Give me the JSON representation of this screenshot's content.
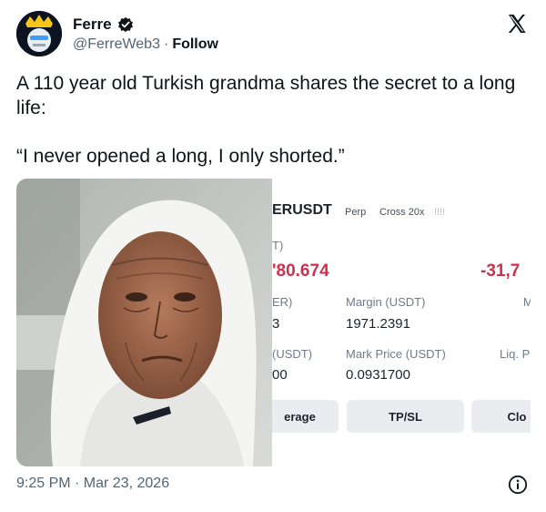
{
  "author": {
    "name": "Ferre",
    "handle": "@FerreWeb3",
    "separator": "·",
    "follow_label": "Follow"
  },
  "tweet": {
    "line1": "A 110 year old Turkish grandma shares the secret to a long life:",
    "quote": "“I never opened a long, I only shorted.”"
  },
  "trade_screenshot": {
    "symbol": "ERUSDT",
    "tag_perp": "Perp",
    "tag_cross": "Cross 20x",
    "tag_bars": "!!!!",
    "pnl_label": "T)",
    "pnl_value": "'80.674",
    "roi_value": "-31,7",
    "size_label": "ER)",
    "margin_label": "Margin (USDT)",
    "margin_ratio_label": "M",
    "size_value": "3",
    "margin_value": "1971.2391",
    "entry_label": "(USDT)",
    "mark_label": "Mark Price (USDT)",
    "liq_label": "Liq. P",
    "entry_value": "00",
    "mark_value": "0.0931700",
    "btn_leverage": "erage",
    "btn_tpsl": "TP/SL",
    "btn_close": "Clo"
  },
  "footer": {
    "timestamp": "9:25 PM · Mar 23, 2026"
  },
  "colors": {
    "negative_red": "#cf304a",
    "text_primary": "#0f1419",
    "text_secondary": "#536471"
  },
  "icons": {
    "verified": "verified-badge-icon",
    "x_logo": "x-logo-icon",
    "info": "info-icon"
  }
}
